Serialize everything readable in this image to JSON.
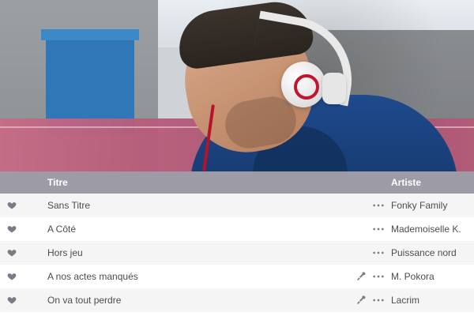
{
  "table": {
    "headers": {
      "title": "Titre",
      "artist": "Artiste"
    },
    "rows": [
      {
        "title": "Sans Titre",
        "artist": "Fonky Family",
        "has_mic": false
      },
      {
        "title": "A Côté",
        "artist": "Mademoiselle K.",
        "has_mic": false
      },
      {
        "title": "Hors jeu",
        "artist": "Puissance nord",
        "has_mic": false
      },
      {
        "title": "A nos actes manqués",
        "artist": "M. Pokora",
        "has_mic": true
      },
      {
        "title": "On va tout perdre",
        "artist": "Lacrim",
        "has_mic": true
      }
    ]
  },
  "icons": {
    "heart": "heart-icon",
    "more": "more-dots-icon",
    "mic": "microphone-icon"
  },
  "colors": {
    "header_bg": "#9d9ba6",
    "row_alt": "#f5f5f5",
    "text": "#4d4d4d",
    "icon": "#7b7b87"
  }
}
